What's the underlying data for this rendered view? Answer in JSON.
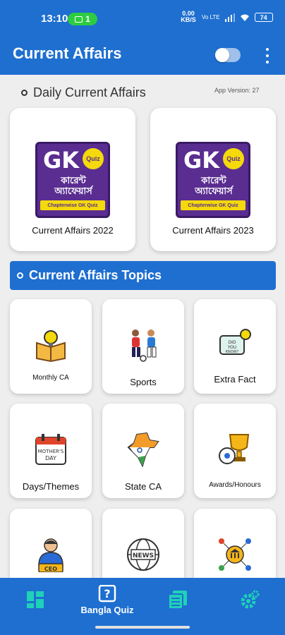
{
  "status_bar": {
    "time": "13:10",
    "pill_count": "1",
    "net_speed": "0.00 KB/S",
    "signal": "Vo LTE",
    "battery": "74"
  },
  "app_bar": {
    "title": "Current Affairs"
  },
  "daily": {
    "title": "Daily Current Affairs",
    "app_version": "App Version: 27"
  },
  "logo": {
    "gk": "GK",
    "quiz": "Quiz",
    "bengali": "কারেন্ট অ্যাফেয়ার্স",
    "strip": "Chapterwise GK Quiz"
  },
  "cards": [
    {
      "label": "Current Affairs 2022"
    },
    {
      "label": "Current Affairs 2023"
    }
  ],
  "topics": {
    "title": "Current Affairs Topics",
    "items": [
      {
        "label": "Monthly CA",
        "icon": "book-lightbulb-icon"
      },
      {
        "label": "Sports",
        "icon": "football-players-icon"
      },
      {
        "label": "Extra Fact",
        "icon": "did-you-know-icon"
      },
      {
        "label": "Days/Themes",
        "icon": "calendar-icon"
      },
      {
        "label": "State CA",
        "icon": "india-map-icon"
      },
      {
        "label": "Awards/Honours",
        "icon": "trophy-icon"
      },
      {
        "label": "",
        "icon": "ceo-icon"
      },
      {
        "label": "",
        "icon": "news-globe-icon"
      },
      {
        "label": "",
        "icon": "bank-network-icon"
      }
    ]
  },
  "bottom_nav": {
    "items": [
      {
        "label": "",
        "icon": "dashboard-icon"
      },
      {
        "label": "Bangla Quiz",
        "icon": "question-icon"
      },
      {
        "label": "",
        "icon": "list-icon"
      },
      {
        "label": "",
        "icon": "settings-icon"
      }
    ]
  },
  "colors": {
    "primary": "#1e6fd0",
    "logo_purple": "#5a2d91",
    "logo_yellow": "#f5d90a"
  }
}
